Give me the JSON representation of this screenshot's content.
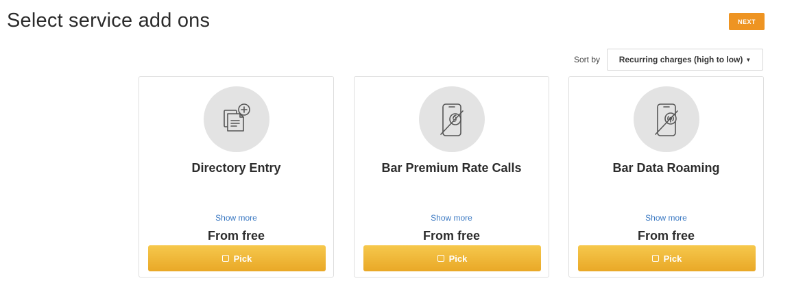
{
  "header": {
    "title": "Select service add ons",
    "next_label": "NEXT"
  },
  "sort": {
    "label": "Sort by",
    "selected": "Recurring charges (high to low)"
  },
  "colors": {
    "accent_orange": "#ee9422",
    "pick_gold": "#f0b83a",
    "link_blue": "#3a78c2",
    "icon_bg": "#e3e3e3"
  },
  "cards": [
    {
      "icon": "document-add-icon",
      "title": "Directory Entry",
      "show_more": "Show more",
      "price": "From free",
      "pick_label": "Pick"
    },
    {
      "icon": "barred-premium-phone-icon",
      "title": "Bar Premium Rate Calls",
      "show_more": "Show more",
      "price": "From free",
      "pick_label": "Pick"
    },
    {
      "icon": "barred-roaming-phone-icon",
      "title": "Bar Data Roaming",
      "show_more": "Show more",
      "price": "From free",
      "pick_label": "Pick"
    }
  ]
}
